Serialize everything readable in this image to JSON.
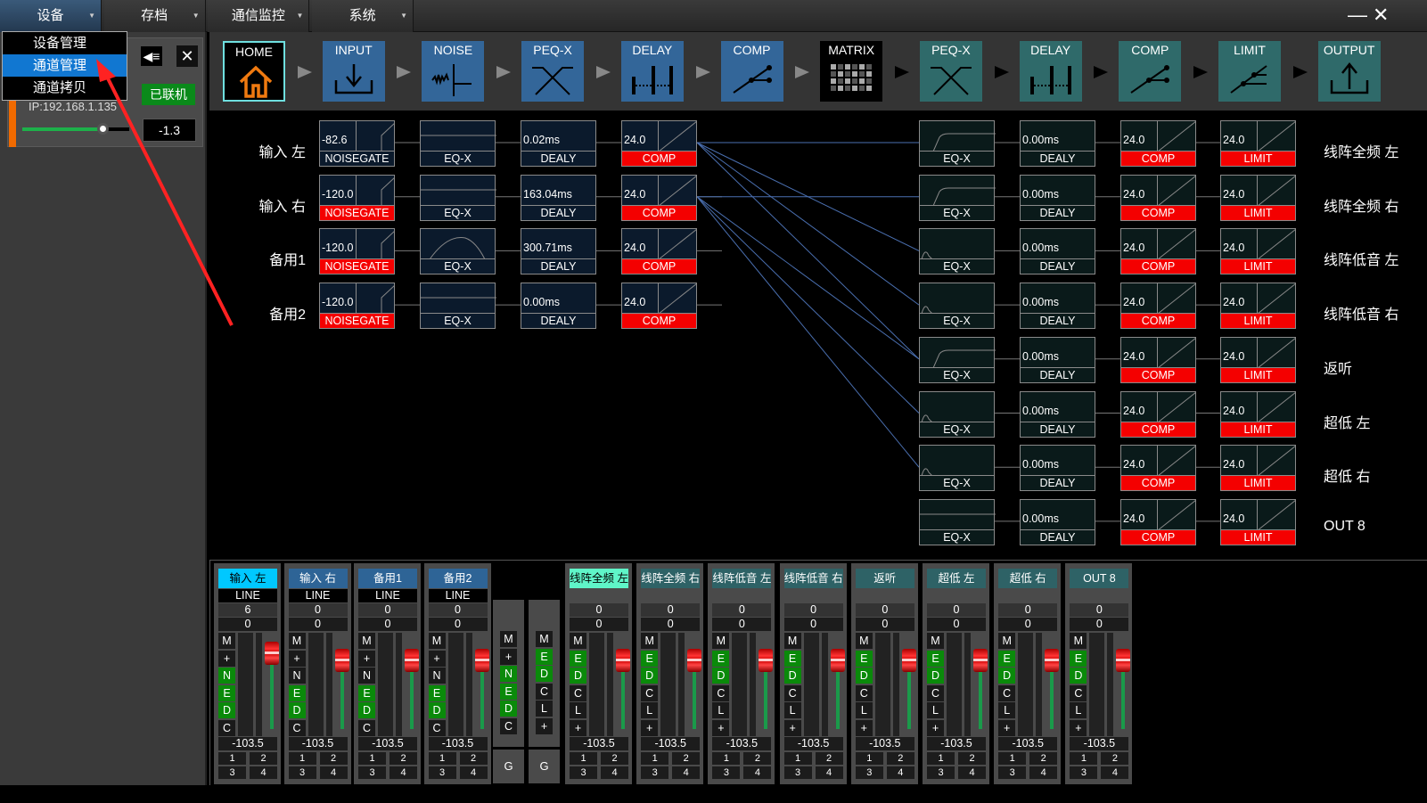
{
  "menubar": {
    "tabs": [
      {
        "label": "设备",
        "active": true
      },
      {
        "label": "存档"
      },
      {
        "label": "通信监控"
      },
      {
        "label": "系统"
      }
    ],
    "minimize": "—",
    "close": "✕"
  },
  "dropdown": {
    "items": [
      {
        "label": "设备管理"
      },
      {
        "label": "通道管理",
        "selected": true
      },
      {
        "label": "通道拷贝"
      }
    ]
  },
  "device": {
    "ip": "IP:192.168.1.135",
    "status": "已联机",
    "speaker_icon": "speaker-icon",
    "close_icon": "✕",
    "volume": "-1.3",
    "volume_fraction": 0.75
  },
  "nav": {
    "buttons": [
      {
        "label": "HOME",
        "icon": "home-icon"
      },
      {
        "label": "INPUT",
        "icon": "input-icon"
      },
      {
        "label": "NOISE",
        "icon": "noise-icon"
      },
      {
        "label": "PEQ-X",
        "icon": "peq-icon"
      },
      {
        "label": "DELAY",
        "icon": "delay-icon"
      },
      {
        "label": "COMP",
        "icon": "comp-icon"
      },
      {
        "label": "MATRIX",
        "icon": "matrix-icon"
      },
      {
        "label": "PEQ-X",
        "icon": "peq-icon"
      },
      {
        "label": "DELAY",
        "icon": "delay-icon"
      },
      {
        "label": "COMP",
        "icon": "comp-icon"
      },
      {
        "label": "LIMIT",
        "icon": "limit-icon"
      },
      {
        "label": "OUTPUT",
        "icon": "output-icon"
      }
    ],
    "colors": {
      "input_stage": "#336699",
      "output_stage": "#2f6a6a",
      "home_border": "#6fe0e0",
      "home_icon": "#f07a10"
    }
  },
  "inputs": [
    {
      "label": "输入 左",
      "gate": "-82.6",
      "gate_active": false,
      "eq": "EQ-X",
      "eq_curve": "flat",
      "delay": "0.02ms",
      "delay_label": "DEALY",
      "comp": "24.0",
      "comp_label": "COMP",
      "gate_label": "NOISEGATE"
    },
    {
      "label": "输入 右",
      "gate": "-120.0",
      "gate_active": true,
      "eq": "EQ-X",
      "eq_curve": "flat",
      "delay": "163.04ms",
      "delay_label": "DEALY",
      "comp": "24.0",
      "comp_label": "COMP",
      "gate_label": "NOISEGATE"
    },
    {
      "label": "备用1",
      "gate": "-120.0",
      "gate_active": true,
      "eq": "EQ-X",
      "eq_curve": "bump",
      "delay": "300.71ms",
      "delay_label": "DEALY",
      "comp": "24.0",
      "comp_label": "COMP",
      "gate_label": "NOISEGATE"
    },
    {
      "label": "备用2",
      "gate": "-120.0",
      "gate_active": true,
      "eq": "EQ-X",
      "eq_curve": "flat",
      "delay": "0.00ms",
      "delay_label": "DEALY",
      "comp": "24.0",
      "comp_label": "COMP",
      "gate_label": "NOISEGATE"
    }
  ],
  "outputs": [
    {
      "label": "线阵全频 左",
      "eq": "EQ-X",
      "eq_curve": "hp",
      "delay": "0.00ms",
      "delay_label": "DEALY",
      "comp": "24.0",
      "comp_label": "COMP",
      "limit": "24.0",
      "limit_label": "LIMIT"
    },
    {
      "label": "线阵全频 右",
      "eq": "EQ-X",
      "eq_curve": "hp",
      "delay": "0.00ms",
      "delay_label": "DEALY",
      "comp": "24.0",
      "comp_label": "COMP",
      "limit": "24.0",
      "limit_label": "LIMIT"
    },
    {
      "label": "线阵低音 左",
      "eq": "EQ-X",
      "eq_curve": "lp",
      "delay": "0.00ms",
      "delay_label": "DEALY",
      "comp": "24.0",
      "comp_label": "COMP",
      "limit": "24.0",
      "limit_label": "LIMIT"
    },
    {
      "label": "线阵低音 右",
      "eq": "EQ-X",
      "eq_curve": "lp",
      "delay": "0.00ms",
      "delay_label": "DEALY",
      "comp": "24.0",
      "comp_label": "COMP",
      "limit": "24.0",
      "limit_label": "LIMIT"
    },
    {
      "label": "返听",
      "eq": "EQ-X",
      "eq_curve": "hp",
      "delay": "0.00ms",
      "delay_label": "DEALY",
      "comp": "24.0",
      "comp_label": "COMP",
      "limit": "24.0",
      "limit_label": "LIMIT"
    },
    {
      "label": "超低 左",
      "eq": "EQ-X",
      "eq_curve": "lp",
      "delay": "0.00ms",
      "delay_label": "DEALY",
      "comp": "24.0",
      "comp_label": "COMP",
      "limit": "24.0",
      "limit_label": "LIMIT"
    },
    {
      "label": "超低 右",
      "eq": "EQ-X",
      "eq_curve": "lp",
      "delay": "0.00ms",
      "delay_label": "DEALY",
      "comp": "24.0",
      "comp_label": "COMP",
      "limit": "24.0",
      "limit_label": "LIMIT"
    },
    {
      "label": "OUT 8",
      "eq": "EQ-X",
      "eq_curve": "flat",
      "delay": "0.00ms",
      "delay_label": "DEALY",
      "comp": "24.0",
      "comp_label": "COMP",
      "limit": "24.0",
      "limit_label": "LIMIT"
    }
  ],
  "matrix_routes": [
    [
      0,
      0
    ],
    [
      0,
      2
    ],
    [
      0,
      3
    ],
    [
      0,
      4
    ],
    [
      1,
      1
    ],
    [
      1,
      4
    ],
    [
      1,
      5
    ],
    [
      1,
      6
    ]
  ],
  "mixer": {
    "inputs": [
      {
        "label": "输入 左",
        "selected": true,
        "source": "LINE",
        "gain": "6",
        "val2": "0",
        "buttons": [
          [
            "M",
            false
          ],
          [
            "+",
            false
          ],
          [
            "N",
            true
          ],
          [
            "E",
            true
          ],
          [
            "D",
            true
          ],
          [
            "C",
            false
          ]
        ],
        "level": "-103.5",
        "routes": [
          "1",
          "2",
          "3",
          "4"
        ]
      },
      {
        "label": "输入 右",
        "source": "LINE",
        "gain": "0",
        "val2": "0",
        "buttons": [
          [
            "M",
            false
          ],
          [
            "+",
            false
          ],
          [
            "N",
            false
          ],
          [
            "E",
            true
          ],
          [
            "D",
            true
          ],
          [
            "C",
            false
          ]
        ],
        "level": "-103.5",
        "routes": [
          "1",
          "2",
          "3",
          "4"
        ]
      },
      {
        "label": "备用1",
        "source": "LINE",
        "gain": "0",
        "val2": "0",
        "buttons": [
          [
            "M",
            false
          ],
          [
            "+",
            false
          ],
          [
            "N",
            false
          ],
          [
            "E",
            true
          ],
          [
            "D",
            true
          ],
          [
            "C",
            false
          ]
        ],
        "level": "-103.5",
        "routes": [
          "1",
          "2",
          "3",
          "4"
        ]
      },
      {
        "label": "备用2",
        "source": "LINE",
        "gain": "0",
        "val2": "0",
        "buttons": [
          [
            "M",
            false
          ],
          [
            "+",
            false
          ],
          [
            "N",
            false
          ],
          [
            "E",
            true
          ],
          [
            "D",
            true
          ],
          [
            "C",
            false
          ]
        ],
        "level": "-103.5",
        "routes": [
          "1",
          "2",
          "3",
          "4"
        ]
      }
    ],
    "groups": [
      {
        "buttons": [
          [
            "M",
            false
          ],
          [
            "+",
            false
          ],
          [
            "N",
            true
          ],
          [
            "E",
            true
          ],
          [
            "D",
            true
          ],
          [
            "C",
            false
          ]
        ],
        "label": "G"
      },
      {
        "buttons": [
          [
            "M",
            false
          ],
          [
            "E",
            true
          ],
          [
            "D",
            true
          ],
          [
            "C",
            false
          ],
          [
            "L",
            false
          ],
          [
            "+",
            false
          ]
        ],
        "label": "G"
      }
    ],
    "outputs": [
      {
        "label": "线阵全频 左",
        "selected": true,
        "gain": "0",
        "val2": "0"
      },
      {
        "label": "线阵全频 右",
        "gain": "0",
        "val2": "0"
      },
      {
        "label": "线阵低音 左",
        "gain": "0",
        "val2": "0"
      },
      {
        "label": "线阵低音 右",
        "gain": "0",
        "val2": "0"
      },
      {
        "label": "返听",
        "gain": "0",
        "val2": "0"
      },
      {
        "label": "超低 左",
        "gain": "0",
        "val2": "0"
      },
      {
        "label": "超低 右",
        "gain": "0",
        "val2": "0"
      },
      {
        "label": "OUT 8",
        "gain": "0",
        "val2": "0"
      }
    ],
    "output_buttons": [
      [
        "M",
        false
      ],
      [
        "E",
        true
      ],
      [
        "D",
        true
      ],
      [
        "C",
        false
      ],
      [
        "L",
        false
      ],
      [
        "+",
        false
      ]
    ],
    "output_level": "-103.5",
    "output_routes": [
      "1",
      "2",
      "3",
      "4"
    ],
    "colors": {
      "input_head": "#2e6496",
      "input_head_selected": "#00c8ff",
      "output_head": "#2e6266",
      "output_head_selected": "#5ff5c8",
      "button_on": "#0a8a0a"
    }
  }
}
